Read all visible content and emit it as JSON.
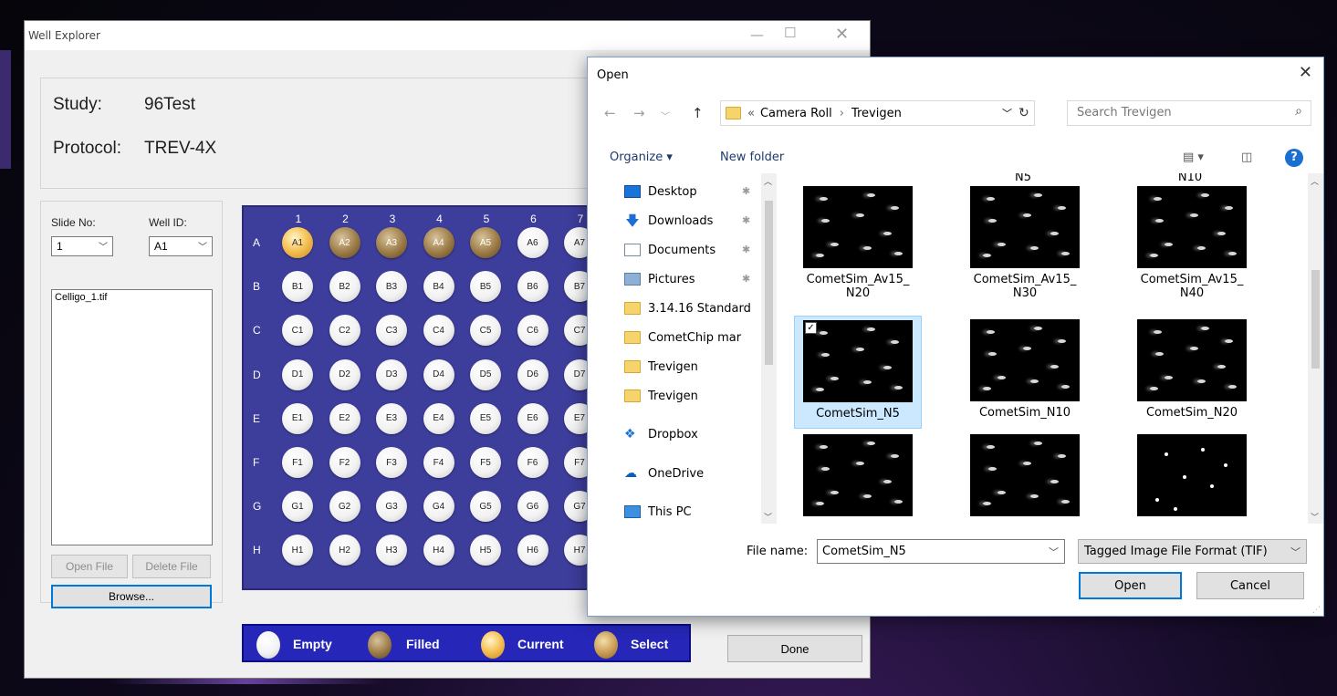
{
  "we": {
    "title": "Well Explorer",
    "study_label": "Study:",
    "study_value": "96Test",
    "protocol_label": "Protocol:",
    "protocol_value": "TREV-4X",
    "slide_label": "Slide No:",
    "slide_value": "1",
    "well_label": "Well ID:",
    "well_value": "A1",
    "files": [
      "Celligo_1.tif"
    ],
    "open_file": "Open File",
    "delete_file": "Delete File",
    "browse": "Browse...",
    "done": "Done",
    "columns": [
      "1",
      "2",
      "3",
      "4",
      "5",
      "6",
      "7"
    ],
    "rows": [
      "A",
      "B",
      "C",
      "D",
      "E",
      "F",
      "G",
      "H"
    ],
    "current_well": "A1",
    "filled_wells": [
      "A2",
      "A3",
      "A4",
      "A5"
    ],
    "legend": {
      "empty": "Empty",
      "filled": "Filled",
      "current": "Current",
      "select": "Select"
    },
    "colors": {
      "plate": "#3d3d9c",
      "legend": "#2626b8",
      "filled": "#9a7a46",
      "current": "#f7c45a"
    }
  },
  "dlg": {
    "title": "Open",
    "path_prefix": "«",
    "path_1": "Camera Roll",
    "path_sep": "›",
    "path_2": "Trevigen",
    "search_placeholder": "Search Trevigen",
    "organize": "Organize ▾",
    "new_folder": "New folder",
    "nav": [
      {
        "label": "Desktop",
        "icon": "desktop-icon",
        "pinned": true
      },
      {
        "label": "Downloads",
        "icon": "download-icon",
        "pinned": true
      },
      {
        "label": "Documents",
        "icon": "documents-icon",
        "pinned": true
      },
      {
        "label": "Pictures",
        "icon": "pictures-icon",
        "pinned": true
      },
      {
        "label": "3.14.16 Standard",
        "icon": "folder-icon",
        "pinned": false
      },
      {
        "label": "CometChip mar",
        "icon": "folder-icon",
        "pinned": false
      },
      {
        "label": "Trevigen",
        "icon": "folder-icon",
        "pinned": false
      },
      {
        "label": "Trevigen",
        "icon": "folder-icon",
        "pinned": false
      },
      {
        "label": "Dropbox",
        "icon": "dropbox-icon",
        "pinned": false
      },
      {
        "label": "OneDrive",
        "icon": "onedrive-icon",
        "pinned": false
      },
      {
        "label": "This PC",
        "icon": "pc-icon",
        "pinned": false
      }
    ],
    "top_partial": [
      "N5",
      "N10"
    ],
    "tiles": [
      [
        "CometSim_Av15_",
        "N20"
      ],
      [
        "CometSim_Av15_",
        "N30"
      ],
      [
        "CometSim_Av15_",
        "N40"
      ],
      [
        "CometSim_N5",
        ""
      ],
      [
        "CometSim_N10",
        ""
      ],
      [
        "CometSim_N20",
        ""
      ],
      [
        "",
        ""
      ],
      [
        "",
        ""
      ],
      [
        "",
        ""
      ]
    ],
    "selected_tile": 3,
    "file_name_label": "File name:",
    "file_name_value": "CometSim_N5",
    "file_type": "Tagged Image File Format (TIF)",
    "open": "Open",
    "cancel": "Cancel"
  }
}
